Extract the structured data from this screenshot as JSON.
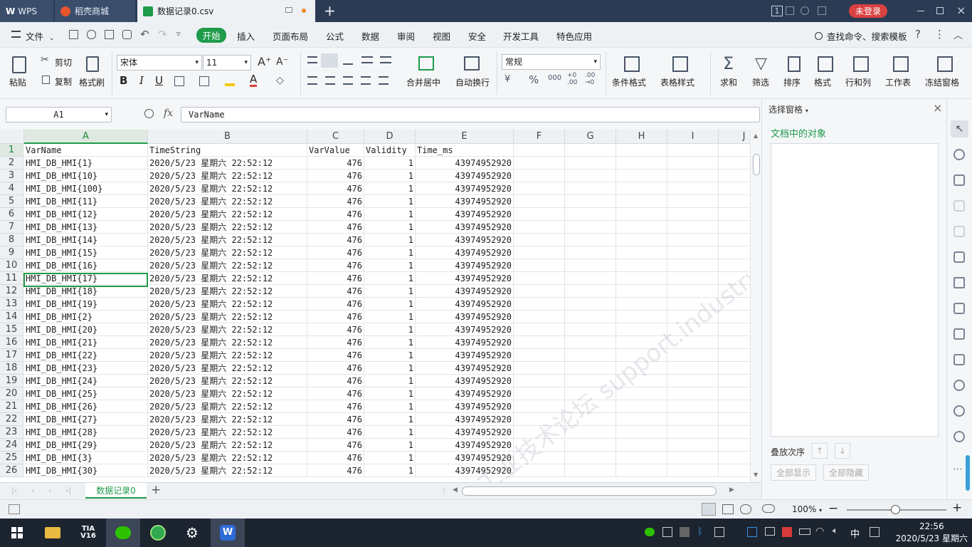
{
  "titlebar": {
    "tabs": [
      {
        "label": "WPS"
      },
      {
        "label": "稻壳商城"
      },
      {
        "label": "数据记录0.csv"
      }
    ],
    "badge": "1",
    "login": "未登录"
  },
  "menu": {
    "file": "文件",
    "items": [
      "开始",
      "插入",
      "页面布局",
      "公式",
      "数据",
      "审阅",
      "视图",
      "安全",
      "开发工具",
      "特色应用"
    ],
    "search": "查找命令、搜索模板"
  },
  "ribbon": {
    "paste": "粘贴",
    "cut": "剪切",
    "copy": "复制",
    "format_painter": "格式刷",
    "font_name": "宋体",
    "font_size": "11",
    "merge_center": "合并居中",
    "wrap_text": "自动换行",
    "number_format": "常规",
    "conditional_format": "条件格式",
    "table_style": "表格样式",
    "sum": "求和",
    "filter": "筛选",
    "sort": "排序",
    "format": "格式",
    "rows_cols": "行和列",
    "worksheet": "工作表",
    "freeze": "冻结窗格"
  },
  "formula_bar": {
    "name_box": "A1",
    "fx": "fx",
    "content": "VarName"
  },
  "sheet": {
    "columns": [
      "A",
      "B",
      "C",
      "D",
      "E",
      "F",
      "G",
      "H",
      "I",
      "J"
    ],
    "rows": [
      [
        "VarName",
        "TimeString",
        "VarValue",
        "Validity",
        "Time_ms"
      ],
      [
        "HMI_DB_HMI{1}",
        "2020/5/23 星期六 22:52:12",
        "476",
        "1",
        "43974952920"
      ],
      [
        "HMI_DB_HMI{10}",
        "2020/5/23 星期六 22:52:12",
        "476",
        "1",
        "43974952920"
      ],
      [
        "HMI_DB_HMI{100}",
        "2020/5/23 星期六 22:52:12",
        "476",
        "1",
        "43974952920"
      ],
      [
        "HMI_DB_HMI{11}",
        "2020/5/23 星期六 22:52:12",
        "476",
        "1",
        "43974952920"
      ],
      [
        "HMI_DB_HMI{12}",
        "2020/5/23 星期六 22:52:12",
        "476",
        "1",
        "43974952920"
      ],
      [
        "HMI_DB_HMI{13}",
        "2020/5/23 星期六 22:52:12",
        "476",
        "1",
        "43974952920"
      ],
      [
        "HMI_DB_HMI{14}",
        "2020/5/23 星期六 22:52:12",
        "476",
        "1",
        "43974952920"
      ],
      [
        "HMI_DB_HMI{15}",
        "2020/5/23 星期六 22:52:12",
        "476",
        "1",
        "43974952920"
      ],
      [
        "HMI_DB_HMI{16}",
        "2020/5/23 星期六 22:52:12",
        "476",
        "1",
        "43974952920"
      ],
      [
        "HMI_DB_HMI{17}",
        "2020/5/23 星期六 22:52:12",
        "476",
        "1",
        "43974952920"
      ],
      [
        "HMI_DB_HMI{18}",
        "2020/5/23 星期六 22:52:12",
        "476",
        "1",
        "43974952920"
      ],
      [
        "HMI_DB_HMI{19}",
        "2020/5/23 星期六 22:52:12",
        "476",
        "1",
        "43974952920"
      ],
      [
        "HMI_DB_HMI{2}",
        "2020/5/23 星期六 22:52:12",
        "476",
        "1",
        "43974952920"
      ],
      [
        "HMI_DB_HMI{20}",
        "2020/5/23 星期六 22:52:12",
        "476",
        "1",
        "43974952920"
      ],
      [
        "HMI_DB_HMI{21}",
        "2020/5/23 星期六 22:52:12",
        "476",
        "1",
        "43974952920"
      ],
      [
        "HMI_DB_HMI{22}",
        "2020/5/23 星期六 22:52:12",
        "476",
        "1",
        "43974952920"
      ],
      [
        "HMI_DB_HMI{23}",
        "2020/5/23 星期六 22:52:12",
        "476",
        "1",
        "43974952920"
      ],
      [
        "HMI_DB_HMI{24}",
        "2020/5/23 星期六 22:52:12",
        "476",
        "1",
        "43974952920"
      ],
      [
        "HMI_DB_HMI{25}",
        "2020/5/23 星期六 22:52:12",
        "476",
        "1",
        "43974952920"
      ],
      [
        "HMI_DB_HMI{26}",
        "2020/5/23 星期六 22:52:12",
        "476",
        "1",
        "43974952920"
      ],
      [
        "HMI_DB_HMI{27}",
        "2020/5/23 星期六 22:52:12",
        "476",
        "1",
        "43974952920"
      ],
      [
        "HMI_DB_HMI{28}",
        "2020/5/23 星期六 22:52:12",
        "476",
        "1",
        "43974952920"
      ],
      [
        "HMI_DB_HMI{29}",
        "2020/5/23 星期六 22:52:12",
        "476",
        "1",
        "43974952920"
      ],
      [
        "HMI_DB_HMI{3}",
        "2020/5/23 星期六 22:52:12",
        "476",
        "1",
        "43974952920"
      ],
      [
        "HMI_DB_HMI{30}",
        "2020/5/23 星期六 22:52:12",
        "476",
        "1",
        "43974952920"
      ]
    ],
    "sheet_tab": "数据记录0",
    "watermark": "西门子工业技术论坛 support.industry.siemens.com/cs"
  },
  "side_panel": {
    "title": "选择窗格",
    "subtitle": "文档中的对象",
    "order_label": "叠放次序",
    "show_all": "全部显示",
    "hide_all": "全部隐藏"
  },
  "status_bar": {
    "zoom": "100%"
  },
  "taskbar": {
    "tia": "TIA V16",
    "time": "22:56",
    "date": "2020/5/23 星期六",
    "ime": "中"
  },
  "colors": {
    "accent": "#1f9b4a",
    "titlebar": "#2b3b54",
    "login": "#d94141"
  }
}
